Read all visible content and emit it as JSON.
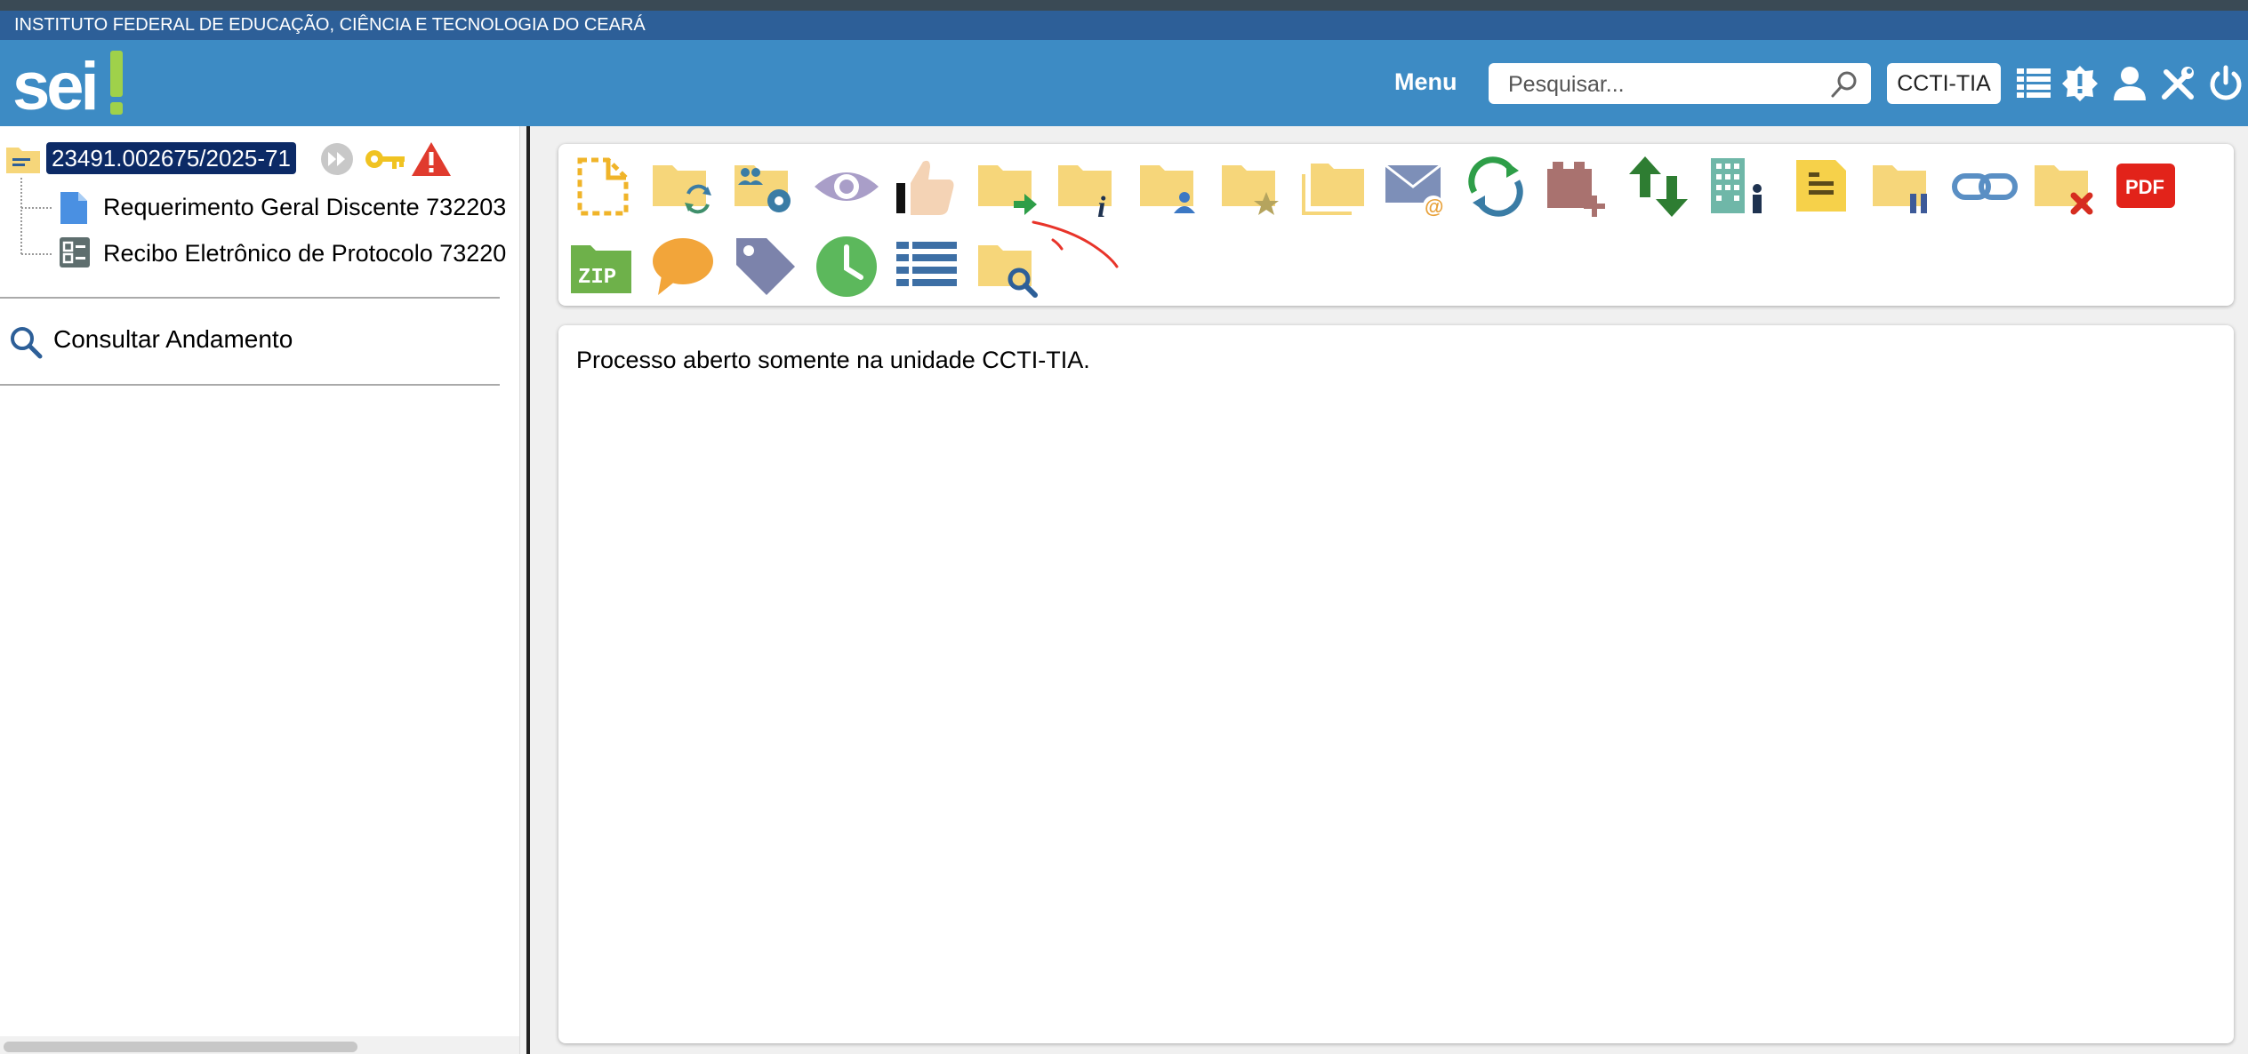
{
  "institution": "INSTITUTO FEDERAL DE EDUCAÇÃO, CIÊNCIA E TECNOLOGIA DO CEARÁ",
  "header": {
    "logo_text": "sei!",
    "menu_label": "Menu",
    "search_placeholder": "Pesquisar...",
    "unit_label": "CCTI-TIA",
    "icons": [
      "list-icon",
      "alert-icon",
      "user-icon",
      "tools-icon",
      "power-icon"
    ]
  },
  "tree": {
    "process_number": "23491.002675/2025-71",
    "process_icons": [
      "folder-icon",
      "forward-icon",
      "key-icon",
      "warning-icon"
    ],
    "documents": [
      {
        "label": "Requerimento Geral Discente 732203",
        "icon": "document-icon"
      },
      {
        "label": "Recibo Eletrônico de Protocolo 73220",
        "icon": "receipt-icon"
      }
    ]
  },
  "sidebar": {
    "consult_label": "Consultar Andamento"
  },
  "toolbar": {
    "row1": [
      "new-document-icon",
      "folder-sync-icon",
      "folder-people-settings-icon",
      "eye-icon",
      "thumbs-up-icon",
      "folder-send-icon",
      "folder-info-icon",
      "folder-user-icon",
      "folder-star-icon",
      "folders-icon",
      "email-icon",
      "refresh-icon",
      "add-block-icon",
      "arrows-updown-icon",
      "building-icon",
      "note-icon",
      "folder-pause-icon",
      "link-icon",
      "folder-close-icon",
      "pdf-icon"
    ],
    "row2": [
      "zip-icon",
      "comment-icon",
      "tag-icon",
      "clock-icon",
      "list-details-icon",
      "folder-search-icon"
    ]
  },
  "content": {
    "message": "Processo aberto somente na unidade CCTI-TIA."
  },
  "colors": {
    "header_blue": "#3d8bc4",
    "institution_bar": "#2d5f98",
    "process_highlight": "#0c2a66",
    "folder_yellow": "#f6d67a"
  }
}
